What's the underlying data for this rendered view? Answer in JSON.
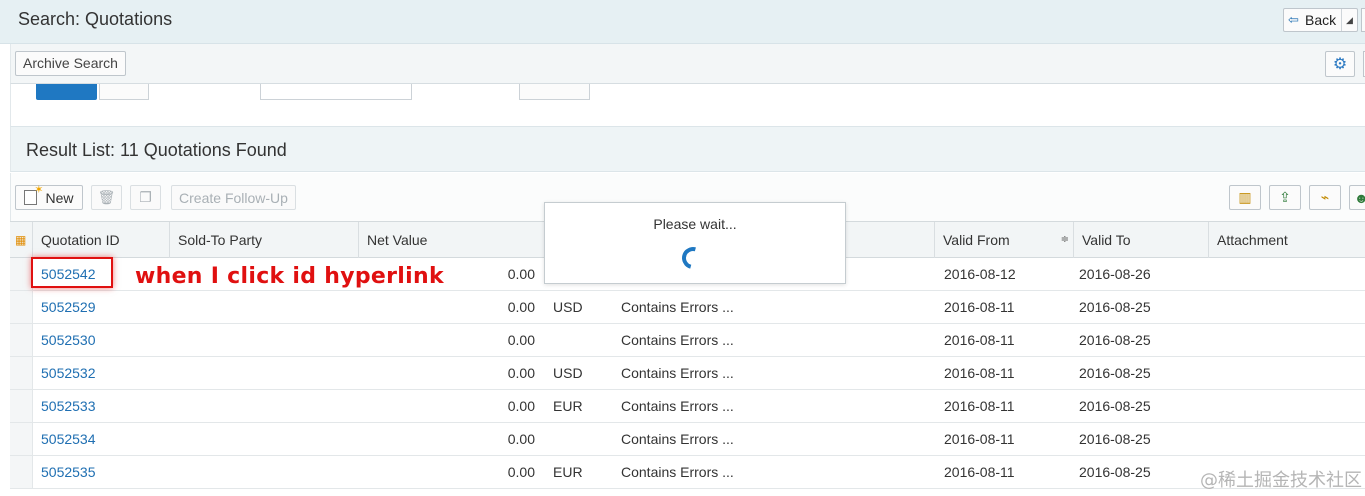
{
  "header": {
    "title": "Search: Quotations",
    "back_label": "Back"
  },
  "toolbar": {
    "archive_search_label": "Archive Search"
  },
  "result": {
    "title": "Result List: 11 Quotations Found"
  },
  "list_toolbar": {
    "new_label": "New",
    "follow_up_label": "Create Follow-Up"
  },
  "table": {
    "columns": [
      "Quotation ID",
      "Sold-To Party",
      "Net Value",
      "Valid From",
      "Valid To",
      "Attachment"
    ],
    "rows": [
      {
        "id": "5052542",
        "net_value": "0.00",
        "currency": "",
        "status": "",
        "valid_from": "2016-08-12",
        "valid_to": "2016-08-26"
      },
      {
        "id": "5052529",
        "net_value": "0.00",
        "currency": "USD",
        "status": "Contains Errors ...",
        "valid_from": "2016-08-11",
        "valid_to": "2016-08-25"
      },
      {
        "id": "5052530",
        "net_value": "0.00",
        "currency": "",
        "status": "Contains Errors ...",
        "valid_from": "2016-08-11",
        "valid_to": "2016-08-25"
      },
      {
        "id": "5052532",
        "net_value": "0.00",
        "currency": "USD",
        "status": "Contains Errors ...",
        "valid_from": "2016-08-11",
        "valid_to": "2016-08-25"
      },
      {
        "id": "5052533",
        "net_value": "0.00",
        "currency": "EUR",
        "status": "Contains Errors ...",
        "valid_from": "2016-08-11",
        "valid_to": "2016-08-25"
      },
      {
        "id": "5052534",
        "net_value": "0.00",
        "currency": "",
        "status": "Contains Errors ...",
        "valid_from": "2016-08-11",
        "valid_to": "2016-08-25"
      },
      {
        "id": "5052535",
        "net_value": "0.00",
        "currency": "EUR",
        "status": "Contains Errors ...",
        "valid_from": "2016-08-11",
        "valid_to": "2016-08-25"
      }
    ]
  },
  "dialog": {
    "text": "Please wait..."
  },
  "annotation": {
    "text": "when I click id hyperlink"
  },
  "watermark": {
    "text": "@稀土掘金技术社区"
  },
  "icons": {
    "back": "back-arrow-icon",
    "settings": "gear-icon",
    "new": "new-document-icon",
    "delete": "trash-icon",
    "copy": "copy-icon",
    "chart": "chart-icon",
    "export": "export-icon",
    "tag": "tag-icon",
    "person": "person-icon",
    "select_column": "column-select-icon",
    "sort": "sort-icon",
    "spinner": "loading-spinner-icon"
  },
  "colors": {
    "link": "#1f6fb2",
    "annotation": "#e01010",
    "accent": "#1f78c2"
  }
}
